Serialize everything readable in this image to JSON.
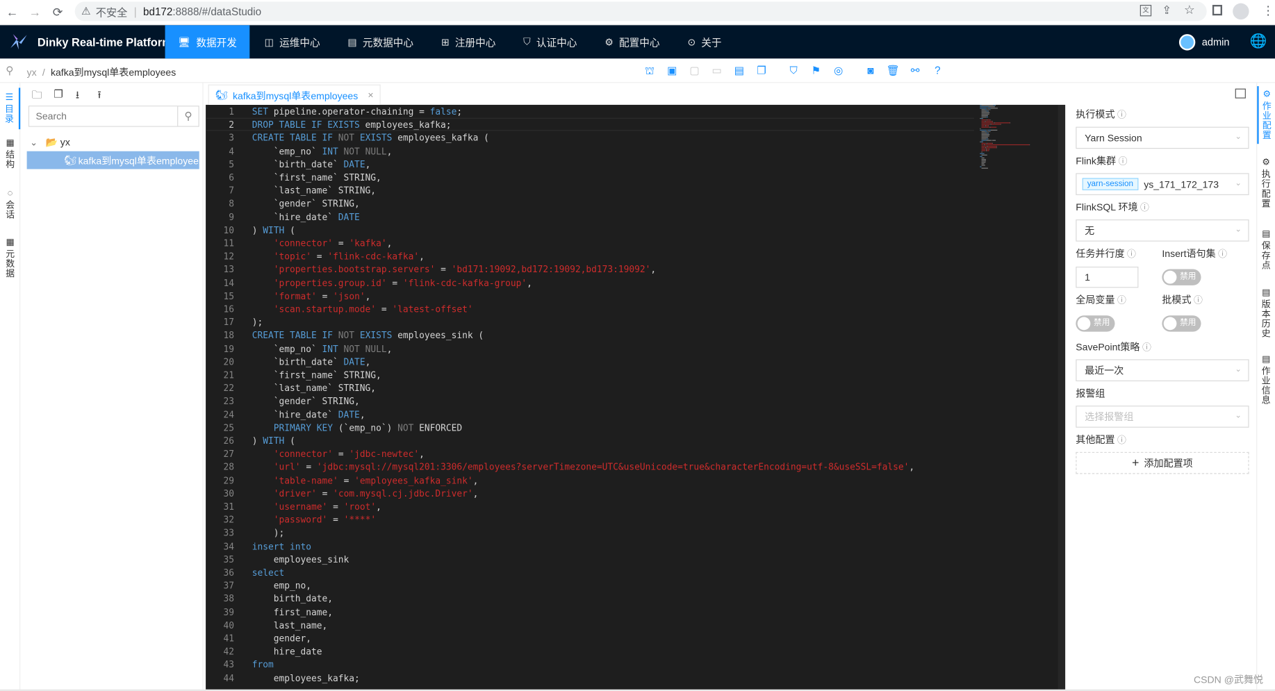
{
  "browser": {
    "back_icon": "←",
    "forward_icon": "→",
    "reload_icon": "⟳",
    "security_label": "不安全",
    "url_host": "bd172",
    "url_path": ":8888/#/dataStudio",
    "warning_icon": "⚠"
  },
  "app": {
    "title": "Dinky Real-time Platform",
    "nav": [
      {
        "icon": "🖥",
        "label": "数据开发",
        "active": true
      },
      {
        "icon": "◫",
        "label": "运维中心"
      },
      {
        "icon": "▤",
        "label": "元数据中心"
      },
      {
        "icon": "⊞",
        "label": "注册中心"
      },
      {
        "icon": "⛉",
        "label": "认证中心"
      },
      {
        "icon": "⚙",
        "label": "配置中心"
      },
      {
        "icon": "⊙",
        "label": "关于"
      }
    ],
    "user": "admin",
    "globe_icon": "🌐"
  },
  "breadcrumb": {
    "root": "yx",
    "sep": "/",
    "current": "kafka到mysql单表employees",
    "pin_icon": "⚲"
  },
  "left_tabs": [
    {
      "icon": "☰",
      "label": "目录",
      "active": true
    },
    {
      "icon": "▦",
      "label": "结构"
    },
    {
      "icon": "◌",
      "label": "会话"
    },
    {
      "icon": "▦",
      "label": "元数据"
    }
  ],
  "tree": {
    "search_placeholder": "Search",
    "search_icon": "⚲",
    "root": {
      "label": "yx",
      "expander": "⌄",
      "icon": "📂"
    },
    "child": {
      "label": "kafka到mysql单表employees",
      "icon": "🐿"
    }
  },
  "editor": {
    "tab_label": "kafka到mysql单表employees",
    "tab_close": "×",
    "tab_icon": "🐿",
    "lines": [
      [
        [
          "k",
          "SET "
        ],
        [
          "",
          "pipeline.operator-chaining = "
        ],
        [
          "k",
          "false"
        ],
        [
          "",
          ";"
        ]
      ],
      [
        [
          "k",
          "DROP TABLE IF EXISTS "
        ],
        [
          "",
          "employees_kafka;"
        ]
      ],
      [
        [
          "k",
          "CREATE TABLE IF "
        ],
        [
          "g",
          "NOT "
        ],
        [
          "k",
          "EXISTS "
        ],
        [
          "",
          "employees_kafka ("
        ]
      ],
      [
        [
          "",
          "    `emp_no` "
        ],
        [
          "k",
          "INT "
        ],
        [
          "g",
          "NOT NULL"
        ],
        [
          "",
          ","
        ]
      ],
      [
        [
          "",
          "    `birth_date` "
        ],
        [
          "k",
          "DATE"
        ],
        [
          "",
          ","
        ]
      ],
      [
        [
          "",
          "    `first_name` STRING,"
        ]
      ],
      [
        [
          "",
          "    `last_name` STRING,"
        ]
      ],
      [
        [
          "",
          "    `gender` STRING,"
        ]
      ],
      [
        [
          "",
          "    `hire_date` "
        ],
        [
          "k",
          "DATE"
        ]
      ],
      [
        [
          "",
          ") "
        ],
        [
          "k",
          "WITH "
        ],
        [
          "",
          "("
        ]
      ],
      [
        [
          "",
          "    "
        ],
        [
          "s",
          "'connector'"
        ],
        [
          "",
          " = "
        ],
        [
          "s",
          "'kafka'"
        ],
        [
          "",
          ","
        ]
      ],
      [
        [
          "",
          "    "
        ],
        [
          "s",
          "'topic'"
        ],
        [
          "",
          " = "
        ],
        [
          "s",
          "'flink-cdc-kafka'"
        ],
        [
          "",
          ","
        ]
      ],
      [
        [
          "",
          "    "
        ],
        [
          "s",
          "'properties.bootstrap.servers'"
        ],
        [
          "",
          " = "
        ],
        [
          "s",
          "'bd171:19092,bd172:19092,bd173:19092'"
        ],
        [
          "",
          ","
        ]
      ],
      [
        [
          "",
          "    "
        ],
        [
          "s",
          "'properties.group.id'"
        ],
        [
          "",
          " = "
        ],
        [
          "s",
          "'flink-cdc-kafka-group'"
        ],
        [
          "",
          ","
        ]
      ],
      [
        [
          "",
          "    "
        ],
        [
          "s",
          "'format'"
        ],
        [
          "",
          " = "
        ],
        [
          "s",
          "'json'"
        ],
        [
          "",
          ","
        ]
      ],
      [
        [
          "",
          "    "
        ],
        [
          "s",
          "'scan.startup.mode'"
        ],
        [
          "",
          " = "
        ],
        [
          "s",
          "'latest-offset'"
        ]
      ],
      [
        [
          "",
          ");"
        ]
      ],
      [
        [
          "k",
          "CREATE TABLE IF "
        ],
        [
          "g",
          "NOT "
        ],
        [
          "k",
          "EXISTS "
        ],
        [
          "",
          "employees_sink ("
        ]
      ],
      [
        [
          "",
          "    `emp_no` "
        ],
        [
          "k",
          "INT "
        ],
        [
          "g",
          "NOT NULL"
        ],
        [
          "",
          ","
        ]
      ],
      [
        [
          "",
          "    `birth_date` "
        ],
        [
          "k",
          "DATE"
        ],
        [
          "",
          ","
        ]
      ],
      [
        [
          "",
          "    `first_name` STRING,"
        ]
      ],
      [
        [
          "",
          "    `last_name` STRING,"
        ]
      ],
      [
        [
          "",
          "    `gender` STRING,"
        ]
      ],
      [
        [
          "",
          "    `hire_date` "
        ],
        [
          "k",
          "DATE"
        ],
        [
          "",
          ","
        ]
      ],
      [
        [
          "",
          "    "
        ],
        [
          "k",
          "PRIMARY KEY "
        ],
        [
          "",
          "(`emp_no`) "
        ],
        [
          "g",
          "NOT "
        ],
        [
          "",
          "ENFORCED"
        ]
      ],
      [
        [
          "",
          ") "
        ],
        [
          "k",
          "WITH "
        ],
        [
          "",
          "("
        ]
      ],
      [
        [
          "",
          "    "
        ],
        [
          "s",
          "'connector'"
        ],
        [
          "",
          " = "
        ],
        [
          "s",
          "'jdbc-newtec'"
        ],
        [
          "",
          ","
        ]
      ],
      [
        [
          "",
          "    "
        ],
        [
          "s",
          "'url'"
        ],
        [
          "",
          " = "
        ],
        [
          "s",
          "'jdbc:mysql://mysql201:3306/employees?serverTimezone=UTC&useUnicode=true&characterEncoding=utf-8&useSSL=false'"
        ],
        [
          "",
          ","
        ]
      ],
      [
        [
          "",
          "    "
        ],
        [
          "s",
          "'table-name'"
        ],
        [
          "",
          " = "
        ],
        [
          "s",
          "'employees_kafka_sink'"
        ],
        [
          "",
          ","
        ]
      ],
      [
        [
          "",
          "    "
        ],
        [
          "s",
          "'driver'"
        ],
        [
          "",
          " = "
        ],
        [
          "s",
          "'com.mysql.cj.jdbc.Driver'"
        ],
        [
          "",
          ","
        ]
      ],
      [
        [
          "",
          "    "
        ],
        [
          "s",
          "'username'"
        ],
        [
          "",
          " = "
        ],
        [
          "s",
          "'root'"
        ],
        [
          "",
          ","
        ]
      ],
      [
        [
          "",
          "    "
        ],
        [
          "s",
          "'password'"
        ],
        [
          "",
          " = "
        ],
        [
          "s",
          "'****'"
        ]
      ],
      [
        [
          "",
          "    );"
        ]
      ],
      [
        [
          "k",
          "insert into"
        ]
      ],
      [
        [
          "",
          "    employees_sink"
        ]
      ],
      [
        [
          "k",
          "select"
        ]
      ],
      [
        [
          "",
          "    emp_no,"
        ]
      ],
      [
        [
          "",
          "    birth_date,"
        ]
      ],
      [
        [
          "",
          "    first_name,"
        ]
      ],
      [
        [
          "",
          "    last_name,"
        ]
      ],
      [
        [
          "",
          "    gender,"
        ]
      ],
      [
        [
          "",
          "    hire_date"
        ]
      ],
      [
        [
          "k",
          "from"
        ]
      ],
      [
        [
          "",
          "    employees_kafka;"
        ]
      ]
    ]
  },
  "config": {
    "exec_mode_label": "执行模式",
    "exec_mode_value": "Yarn Session",
    "cluster_label": "Flink集群",
    "cluster_tag": "yarn-session",
    "cluster_value": "ys_171_172_173",
    "env_label": "FlinkSQL 环境",
    "env_value": "无",
    "parallel_label": "任务并行度",
    "parallel_value": "1",
    "insert_label": "Insert语句集",
    "global_var_label": "全局变量",
    "batch_label": "批模式",
    "switch_off_text": "禁用",
    "savepoint_label": "SavePoint策略",
    "savepoint_value": "最近一次",
    "alarm_label": "报警组",
    "alarm_placeholder": "选择报警组",
    "other_label": "其他配置",
    "add_label": "添加配置项",
    "help_icon": "ⓘ",
    "dropdown_icon": "⌄"
  },
  "right_tabs": [
    {
      "icon": "⚙",
      "label": "作业配置",
      "active": true
    },
    {
      "icon": "⚙",
      "label": "执行配置"
    },
    {
      "icon": "▤",
      "label": "保存点"
    },
    {
      "icon": "▤",
      "label": "版本历史"
    },
    {
      "icon": "▤",
      "label": "作业信息"
    }
  ],
  "watermark": "CSDN @武舞悦",
  "colors": {
    "accent": "#1890ff",
    "header_bg": "#001529",
    "editor_bg": "#1e1e1e"
  }
}
